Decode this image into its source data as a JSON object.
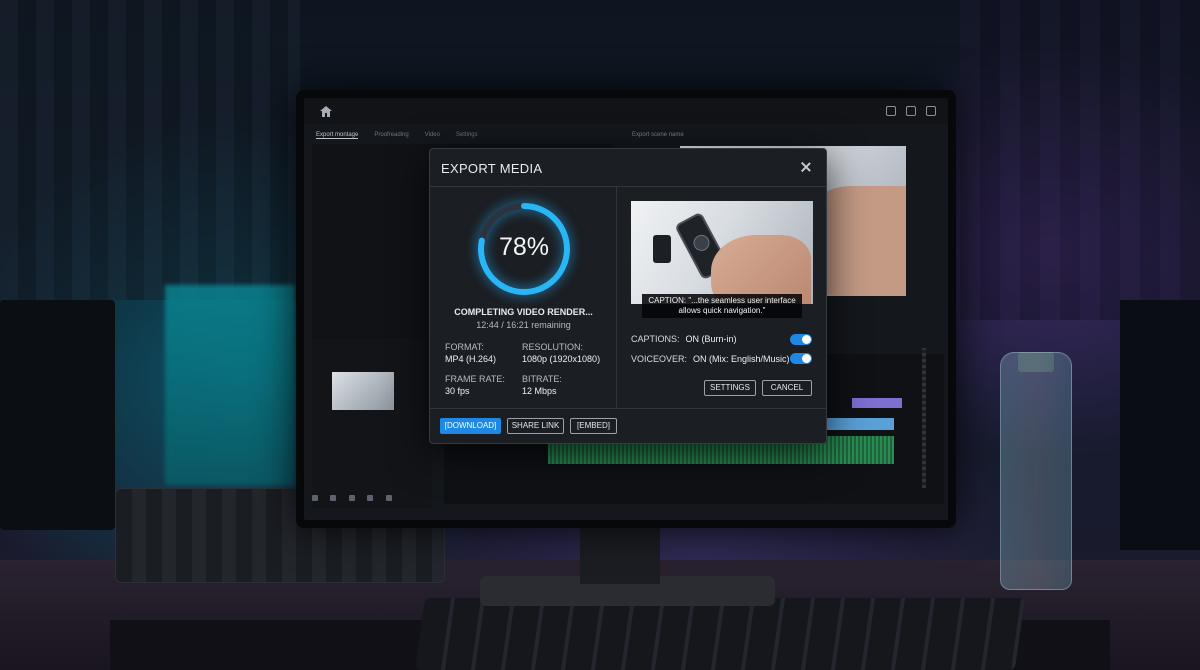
{
  "app": {
    "tabs": [
      {
        "label": "Export montage"
      },
      {
        "label": "Proofreading"
      },
      {
        "label": "Video"
      },
      {
        "label": "Settings"
      }
    ],
    "right_tab": "Export scene name"
  },
  "dialog": {
    "title": "EXPORT MEDIA",
    "progress": {
      "percent": 78,
      "percent_label": "78%",
      "status": "COMPLETING VIDEO RENDER...",
      "time": "12:44 / 16:21 remaining"
    },
    "specs": {
      "format_label": "FORMAT:",
      "format_value": "MP4 (H.264)",
      "resolution_label": "RESOLUTION:",
      "resolution_value": "1080p (1920x1080)",
      "framerate_label": "FRAME RATE:",
      "framerate_value": "30 fps",
      "bitrate_label": "BITRATE:",
      "bitrate_value": "12 Mbps"
    },
    "caption_text": "CAPTION: \"...the seamless user interface allows quick navigation.\"",
    "options": {
      "captions_label": "CAPTIONS:",
      "captions_value": "ON (Burn-in)",
      "captions_on": true,
      "voiceover_label": "VOICEOVER:",
      "voiceover_value": "ON (Mix: English/Music)",
      "voiceover_on": true
    },
    "buttons": {
      "settings": "SETTINGS",
      "cancel": "CANCEL",
      "download": "[DOWNLOAD]",
      "share": "SHARE LINK",
      "embed": "[EMBED]"
    }
  },
  "colors": {
    "accent": "#1e88e5",
    "ring": "#29b6f6",
    "dialog_bg": "#1b1e23"
  }
}
